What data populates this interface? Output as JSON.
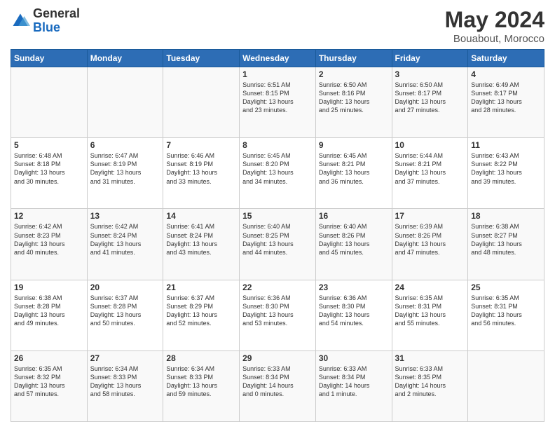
{
  "header": {
    "logo_general": "General",
    "logo_blue": "Blue",
    "month_year": "May 2024",
    "location": "Bouabout, Morocco"
  },
  "weekdays": [
    "Sunday",
    "Monday",
    "Tuesday",
    "Wednesday",
    "Thursday",
    "Friday",
    "Saturday"
  ],
  "weeks": [
    [
      {
        "date": "",
        "info": ""
      },
      {
        "date": "",
        "info": ""
      },
      {
        "date": "",
        "info": ""
      },
      {
        "date": "1",
        "info": "Sunrise: 6:51 AM\nSunset: 8:15 PM\nDaylight: 13 hours\nand 23 minutes."
      },
      {
        "date": "2",
        "info": "Sunrise: 6:50 AM\nSunset: 8:16 PM\nDaylight: 13 hours\nand 25 minutes."
      },
      {
        "date": "3",
        "info": "Sunrise: 6:50 AM\nSunset: 8:17 PM\nDaylight: 13 hours\nand 27 minutes."
      },
      {
        "date": "4",
        "info": "Sunrise: 6:49 AM\nSunset: 8:17 PM\nDaylight: 13 hours\nand 28 minutes."
      }
    ],
    [
      {
        "date": "5",
        "info": "Sunrise: 6:48 AM\nSunset: 8:18 PM\nDaylight: 13 hours\nand 30 minutes."
      },
      {
        "date": "6",
        "info": "Sunrise: 6:47 AM\nSunset: 8:19 PM\nDaylight: 13 hours\nand 31 minutes."
      },
      {
        "date": "7",
        "info": "Sunrise: 6:46 AM\nSunset: 8:19 PM\nDaylight: 13 hours\nand 33 minutes."
      },
      {
        "date": "8",
        "info": "Sunrise: 6:45 AM\nSunset: 8:20 PM\nDaylight: 13 hours\nand 34 minutes."
      },
      {
        "date": "9",
        "info": "Sunrise: 6:45 AM\nSunset: 8:21 PM\nDaylight: 13 hours\nand 36 minutes."
      },
      {
        "date": "10",
        "info": "Sunrise: 6:44 AM\nSunset: 8:21 PM\nDaylight: 13 hours\nand 37 minutes."
      },
      {
        "date": "11",
        "info": "Sunrise: 6:43 AM\nSunset: 8:22 PM\nDaylight: 13 hours\nand 39 minutes."
      }
    ],
    [
      {
        "date": "12",
        "info": "Sunrise: 6:42 AM\nSunset: 8:23 PM\nDaylight: 13 hours\nand 40 minutes."
      },
      {
        "date": "13",
        "info": "Sunrise: 6:42 AM\nSunset: 8:24 PM\nDaylight: 13 hours\nand 41 minutes."
      },
      {
        "date": "14",
        "info": "Sunrise: 6:41 AM\nSunset: 8:24 PM\nDaylight: 13 hours\nand 43 minutes."
      },
      {
        "date": "15",
        "info": "Sunrise: 6:40 AM\nSunset: 8:25 PM\nDaylight: 13 hours\nand 44 minutes."
      },
      {
        "date": "16",
        "info": "Sunrise: 6:40 AM\nSunset: 8:26 PM\nDaylight: 13 hours\nand 45 minutes."
      },
      {
        "date": "17",
        "info": "Sunrise: 6:39 AM\nSunset: 8:26 PM\nDaylight: 13 hours\nand 47 minutes."
      },
      {
        "date": "18",
        "info": "Sunrise: 6:38 AM\nSunset: 8:27 PM\nDaylight: 13 hours\nand 48 minutes."
      }
    ],
    [
      {
        "date": "19",
        "info": "Sunrise: 6:38 AM\nSunset: 8:28 PM\nDaylight: 13 hours\nand 49 minutes."
      },
      {
        "date": "20",
        "info": "Sunrise: 6:37 AM\nSunset: 8:28 PM\nDaylight: 13 hours\nand 50 minutes."
      },
      {
        "date": "21",
        "info": "Sunrise: 6:37 AM\nSunset: 8:29 PM\nDaylight: 13 hours\nand 52 minutes."
      },
      {
        "date": "22",
        "info": "Sunrise: 6:36 AM\nSunset: 8:30 PM\nDaylight: 13 hours\nand 53 minutes."
      },
      {
        "date": "23",
        "info": "Sunrise: 6:36 AM\nSunset: 8:30 PM\nDaylight: 13 hours\nand 54 minutes."
      },
      {
        "date": "24",
        "info": "Sunrise: 6:35 AM\nSunset: 8:31 PM\nDaylight: 13 hours\nand 55 minutes."
      },
      {
        "date": "25",
        "info": "Sunrise: 6:35 AM\nSunset: 8:31 PM\nDaylight: 13 hours\nand 56 minutes."
      }
    ],
    [
      {
        "date": "26",
        "info": "Sunrise: 6:35 AM\nSunset: 8:32 PM\nDaylight: 13 hours\nand 57 minutes."
      },
      {
        "date": "27",
        "info": "Sunrise: 6:34 AM\nSunset: 8:33 PM\nDaylight: 13 hours\nand 58 minutes."
      },
      {
        "date": "28",
        "info": "Sunrise: 6:34 AM\nSunset: 8:33 PM\nDaylight: 13 hours\nand 59 minutes."
      },
      {
        "date": "29",
        "info": "Sunrise: 6:33 AM\nSunset: 8:34 PM\nDaylight: 14 hours\nand 0 minutes."
      },
      {
        "date": "30",
        "info": "Sunrise: 6:33 AM\nSunset: 8:34 PM\nDaylight: 14 hours\nand 1 minute."
      },
      {
        "date": "31",
        "info": "Sunrise: 6:33 AM\nSunset: 8:35 PM\nDaylight: 14 hours\nand 2 minutes."
      },
      {
        "date": "",
        "info": ""
      }
    ]
  ]
}
